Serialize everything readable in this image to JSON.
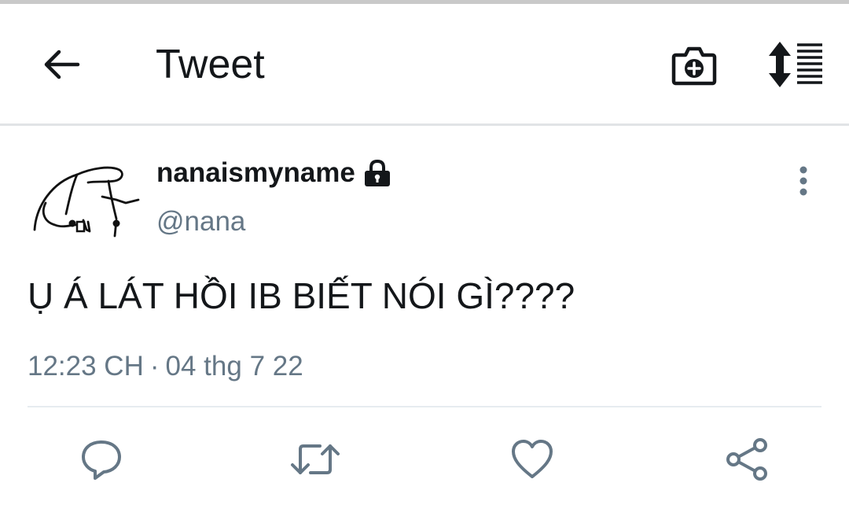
{
  "header": {
    "title": "Tweet",
    "back_icon": "arrow-left-icon",
    "camera_icon": "camera-add-icon",
    "sort_icon": "sort-list-icon"
  },
  "tweet": {
    "display_name": "nanaismyname",
    "protected_icon": "lock-icon",
    "handle": "@nana",
    "text": "Ụ Á LÁT HỒI IB BIẾT NÓI GÌ????",
    "time": "12:23 CH",
    "separator": "·",
    "date": "04 thg 7 22"
  },
  "actions": {
    "reply_icon": "reply-icon",
    "retweet_icon": "retweet-icon",
    "like_icon": "heart-icon",
    "share_icon": "share-icon"
  },
  "colors": {
    "text_primary": "#14171a",
    "text_secondary": "#657786",
    "icon_gray": "#657786",
    "divider": "#e6ecf0"
  }
}
